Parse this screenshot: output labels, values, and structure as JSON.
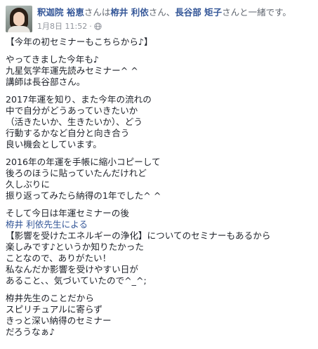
{
  "post": {
    "author": "釈迦院 裕恵",
    "with_text_1": "さんは",
    "tag_1": "栫井 利依",
    "with_text_2": "さん、",
    "tag_2": "長谷部 矩子",
    "with_text_3": "さんと一緒です。",
    "date": "1月8日 11:52",
    "separator": "·",
    "privacy_icon": "globe-icon",
    "paragraphs": [
      [
        "【今年の初セミナーもこちらから♪】"
      ],
      [
        "やってきました今年も♪",
        "九星気学年運先読みセミナー^ ^",
        "講師は長谷部さん。"
      ],
      [
        "2017年運を知り、また今年の流れの",
        "中で自分がどうあっていきたいか",
        "（活きたいか、生きたいか）、どう",
        "行動するかなど自分と向き合う",
        "良い機会としています。"
      ],
      [
        "2016年の年運を手帳に縮小コピーして",
        "後ろのほうに貼っていたんだけれど",
        "久しぶりに",
        "振り返ってみたら納得の1年でした^ ^"
      ],
      [
        "そして今日は年運セミナーの後",
        "栫井 利依先生による",
        "【影響を受けたエネルギーの浄化】についてのセミナーもあるから",
        "楽しみです♪というか知りたかった",
        "ことなので、ありがたい！",
        "私なんだか影響を受けやすい日が",
        "あること、、気づいていたので^_^;"
      ],
      [
        "栫井先生のことだから",
        "スピリチュアルに寄らず",
        "きっと深い納得のセミナー",
        "だろうなぁ♪"
      ]
    ]
  }
}
